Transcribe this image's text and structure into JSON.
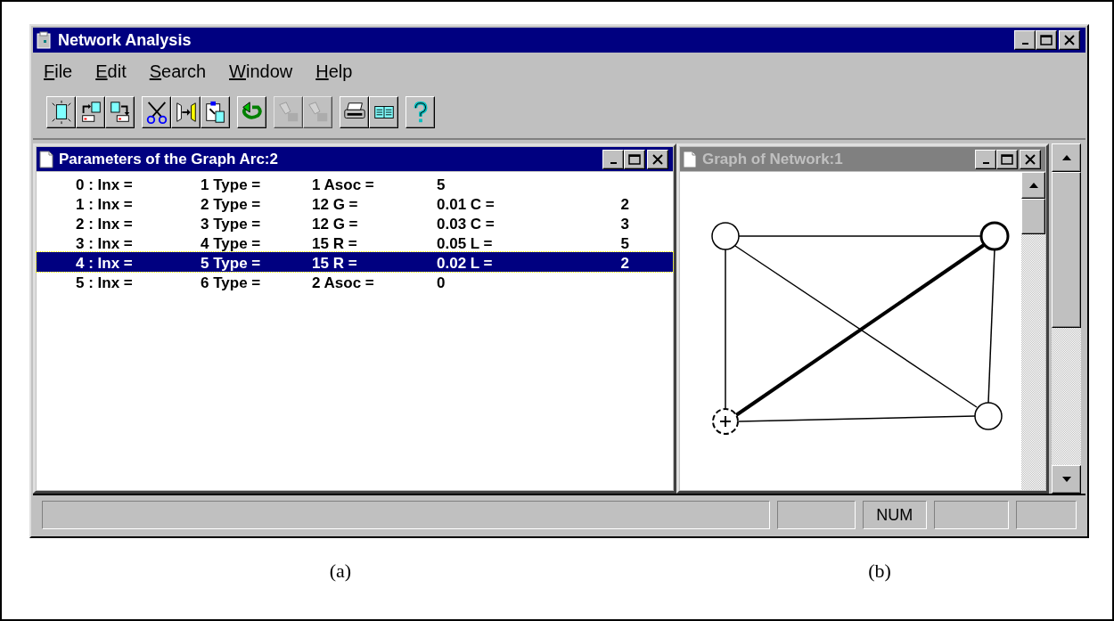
{
  "window": {
    "title": "Network Analysis"
  },
  "menu": [
    {
      "label": "File"
    },
    {
      "label": "Edit"
    },
    {
      "label": "Search"
    },
    {
      "label": "Window"
    },
    {
      "label": "Help"
    }
  ],
  "toolbar": [
    {
      "buttons": [
        {
          "disabled": false
        },
        {
          "disabled": false
        },
        {
          "disabled": false
        }
      ]
    },
    {
      "buttons": [
        {
          "disabled": false
        },
        {
          "disabled": false
        },
        {
          "disabled": false
        }
      ]
    },
    {
      "buttons": [
        {
          "disabled": false
        }
      ]
    },
    {
      "buttons": [
        {
          "disabled": true
        },
        {
          "disabled": true
        }
      ]
    },
    {
      "buttons": [
        {
          "disabled": false
        },
        {
          "disabled": false
        }
      ]
    },
    {
      "buttons": [
        {
          "disabled": false
        }
      ]
    }
  ],
  "parameters_window": {
    "title": "Parameters of the Graph Arc:2",
    "active": true,
    "rows": [
      {
        "selected": false,
        "cells": [
          "0 : Inx =",
          "1 Type =",
          "1 Asoc =",
          "5"
        ]
      },
      {
        "selected": false,
        "cells": [
          "1 : Inx =",
          "2 Type =",
          "12 G =",
          "0.01 C =",
          "2"
        ]
      },
      {
        "selected": false,
        "cells": [
          "2 : Inx =",
          "3 Type =",
          "12 G =",
          "0.03 C =",
          "3"
        ]
      },
      {
        "selected": false,
        "cells": [
          "3 : Inx =",
          "4 Type =",
          "15 R =",
          "0.05 L =",
          "5"
        ]
      },
      {
        "selected": true,
        "cells": [
          "4 : Inx =",
          "5 Type =",
          "15 R =",
          "0.02 L =",
          "2"
        ]
      },
      {
        "selected": false,
        "cells": [
          "5 : Inx =",
          "6 Type =",
          "2 Asoc =",
          "0"
        ]
      }
    ]
  },
  "graph_window": {
    "title": "Graph of Network:1",
    "active": false
  },
  "status_bar": {
    "indicators": [
      "NUM"
    ]
  },
  "captions": [
    "(a)",
    "(b)"
  ]
}
